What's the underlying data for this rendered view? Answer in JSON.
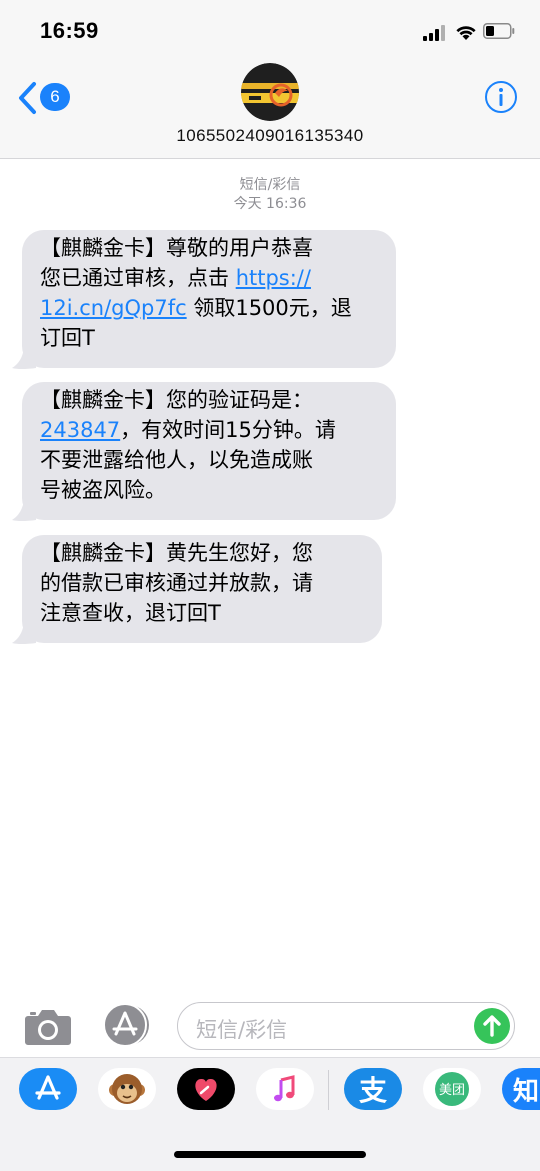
{
  "status_bar": {
    "time": "16:59"
  },
  "header": {
    "back_badge": "6",
    "contact_number": "1065502409016135340"
  },
  "conversation": {
    "service_label": "短信/彩信",
    "timestamp": "今天 16:36",
    "messages": [
      {
        "line1": "【麒麟金卡】尊敬的用户恭喜",
        "line2_pre": "您已通过审核，点击 ",
        "link_part1": "https://",
        "link_part2": "12i.cn/gQp7fc",
        "line3_post": " 领取1500元，退",
        "line4": "订回T"
      },
      {
        "line1": "【麒麟金卡】您的验证码是：",
        "code": "243847",
        "line2_post": "，有效时间15分钟。请",
        "line3": "不要泄露给他人，以免造成账",
        "line4": "号被盗风险。"
      },
      {
        "line1": "【麒麟金卡】黄先生您好，您",
        "line2": "的借款已审核通过并放款，请",
        "line3": "注意查收，退订回T"
      }
    ]
  },
  "input_bar": {
    "placeholder": "短信/彩信"
  },
  "app_drawer": {
    "apps": [
      {
        "name": "app-store",
        "color": "#1a8cf5"
      },
      {
        "name": "animoji",
        "color": "#ffffff"
      },
      {
        "name": "digital-touch",
        "color": "#000000"
      },
      {
        "name": "music",
        "color": "#ffffff"
      },
      {
        "name": "alipay",
        "color": "#1a8ae6",
        "label": "支"
      },
      {
        "name": "meituan",
        "color": "#ffffff",
        "label": "美团"
      },
      {
        "name": "zhihu",
        "color": "#1a82fb",
        "label": "知"
      }
    ]
  },
  "colors": {
    "accent": "#1a82fb",
    "bubble": "#e5e5ea",
    "send": "#36c45a"
  }
}
